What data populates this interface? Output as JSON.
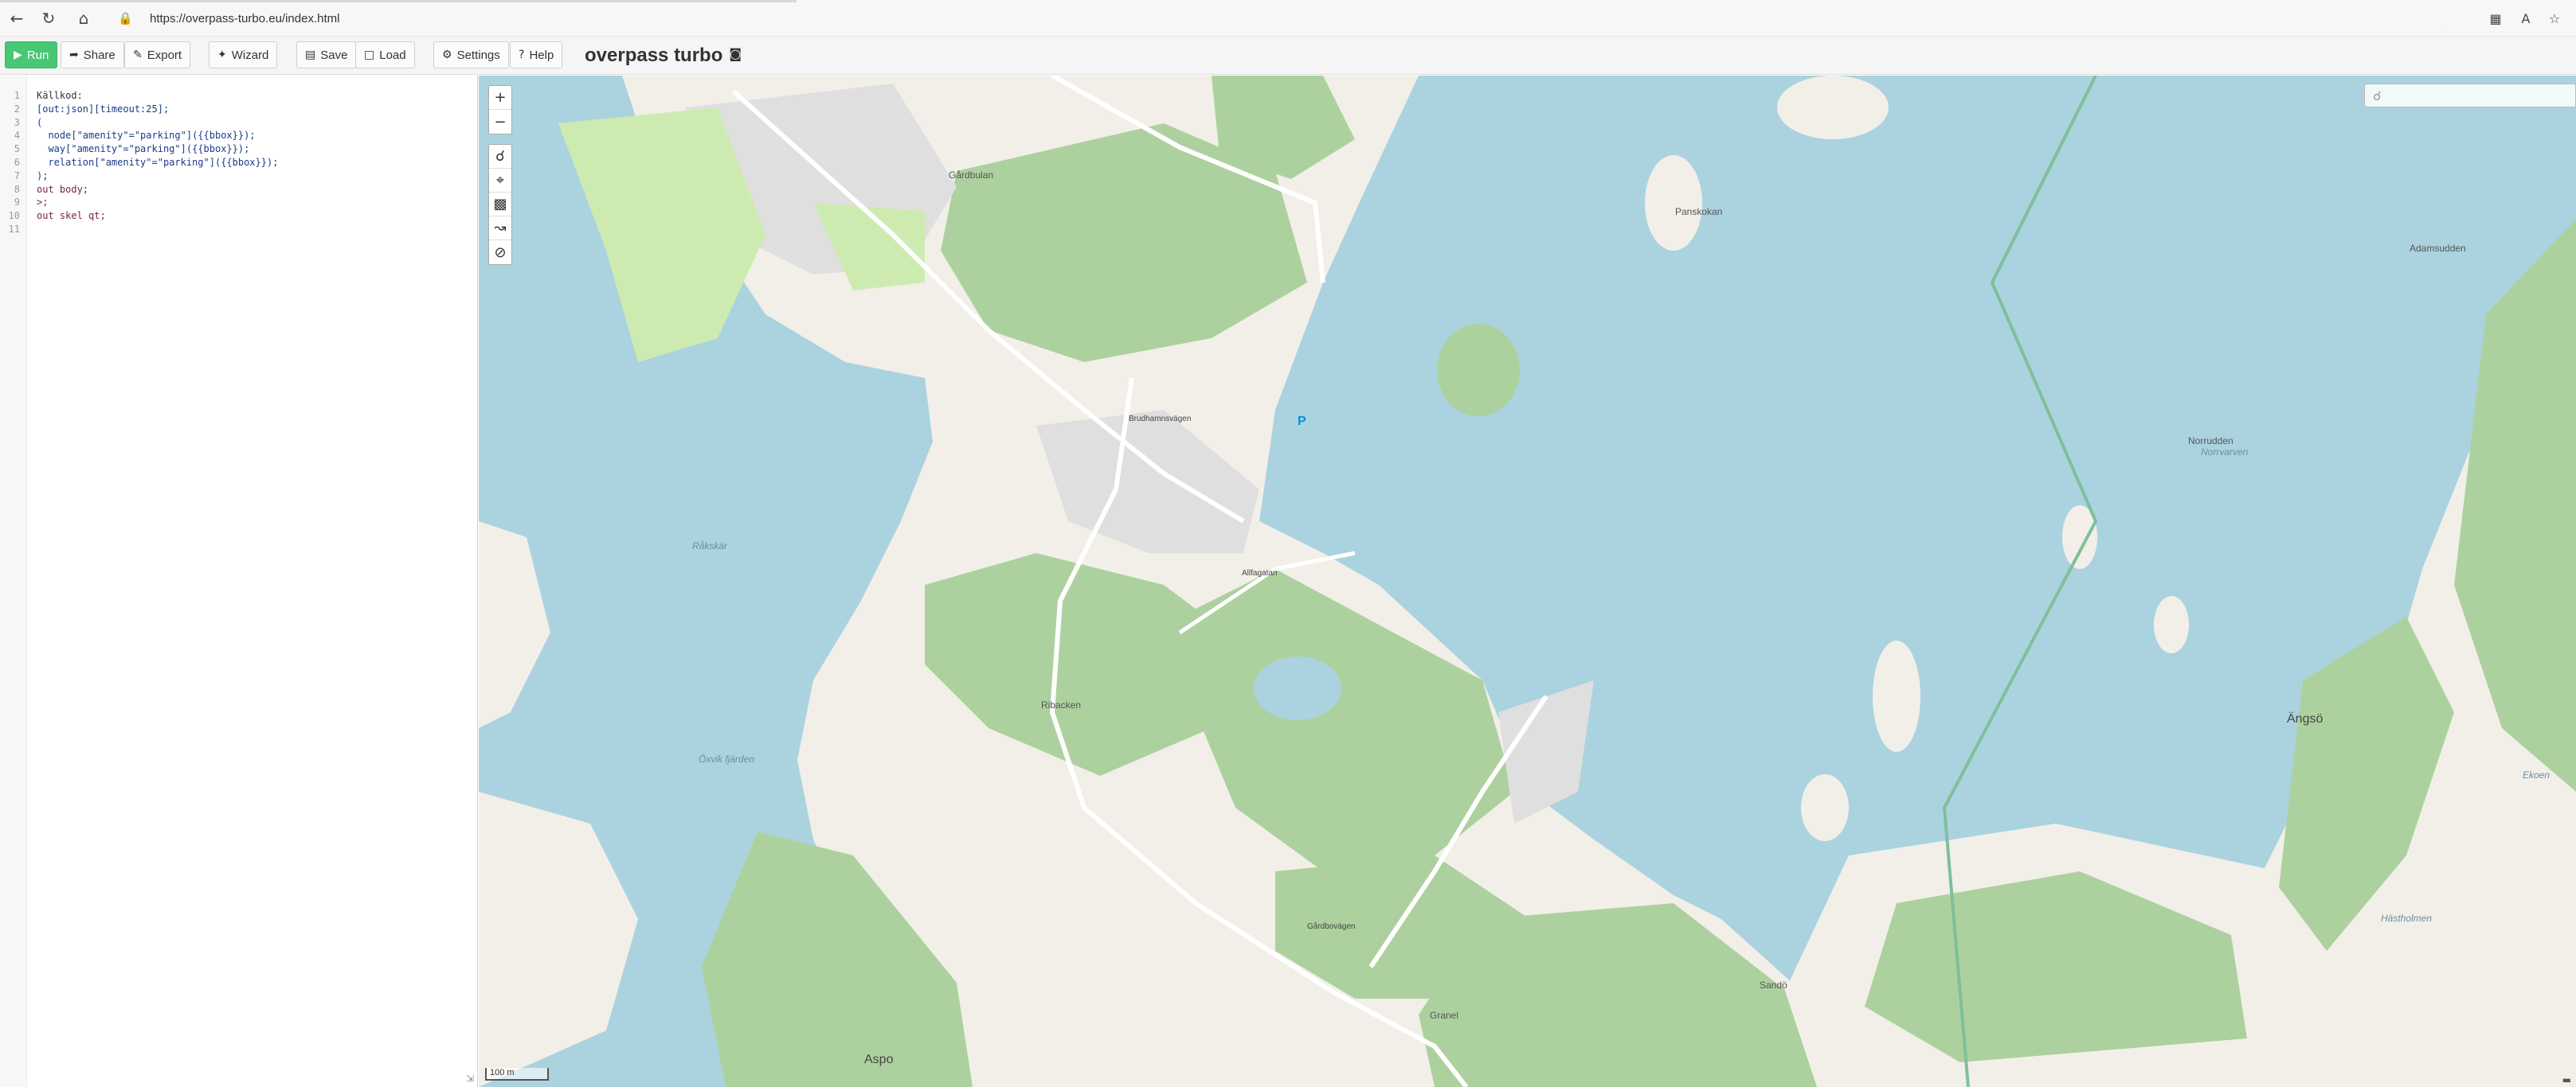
{
  "browser": {
    "url": "https://overpass-turbo.eu/index.html"
  },
  "toolbar": {
    "run": "Run",
    "share": "Share",
    "export": "Export",
    "wizard": "Wizard",
    "save": "Save",
    "load": "Load",
    "settings": "Settings",
    "help": "Help",
    "title": "overpass turbo"
  },
  "editor": {
    "lines": [
      {
        "n": "1",
        "text": "Källkod:"
      },
      {
        "n": "2",
        "text": "[out:json][timeout:25];"
      },
      {
        "n": "3",
        "text": "("
      },
      {
        "n": "4",
        "text": "  node[\"amenity\"=\"parking\"]({{bbox}});"
      },
      {
        "n": "5",
        "text": "  way[\"amenity\"=\"parking\"]({{bbox}});"
      },
      {
        "n": "6",
        "text": "  relation[\"amenity\"=\"parking\"]({{bbox}});"
      },
      {
        "n": "7",
        "text": ");"
      },
      {
        "n": "8",
        "text": "out body;"
      },
      {
        "n": "9",
        "text": ">;"
      },
      {
        "n": "10",
        "text": "out skel qt;"
      },
      {
        "n": "11",
        "text": ""
      }
    ]
  },
  "map": {
    "scale": "100 m",
    "labels": {
      "angso": "Ängsö",
      "aspo": "Aspo",
      "sando": "Sandö",
      "gransten": "Granel",
      "ribacken": "Ribacken",
      "rakskar": "Råkskär",
      "norrudden": "Norrudden",
      "adamsudden": "Adamsudden",
      "pansekokan": "Panskokan",
      "gardbulan": "Gårdbulan",
      "storfjarden": "Öxvik fjärden",
      "brudhamnsvagen": "Brudhamnsvägen",
      "allfagatan": "Allfagatan",
      "gardbovagen": "Gårdbovägen",
      "norrvaren": "Norrvarven",
      "hastholmen": "Hästholmen",
      "ekoen": "Ekoen"
    },
    "parking_symbol": "P"
  },
  "colors": {
    "water": "#aad3df",
    "forest": "#add19e",
    "land": "#f2efe9",
    "residential": "#e0dfdf",
    "meadow": "#cdebb0",
    "run_button": "#48c774"
  }
}
